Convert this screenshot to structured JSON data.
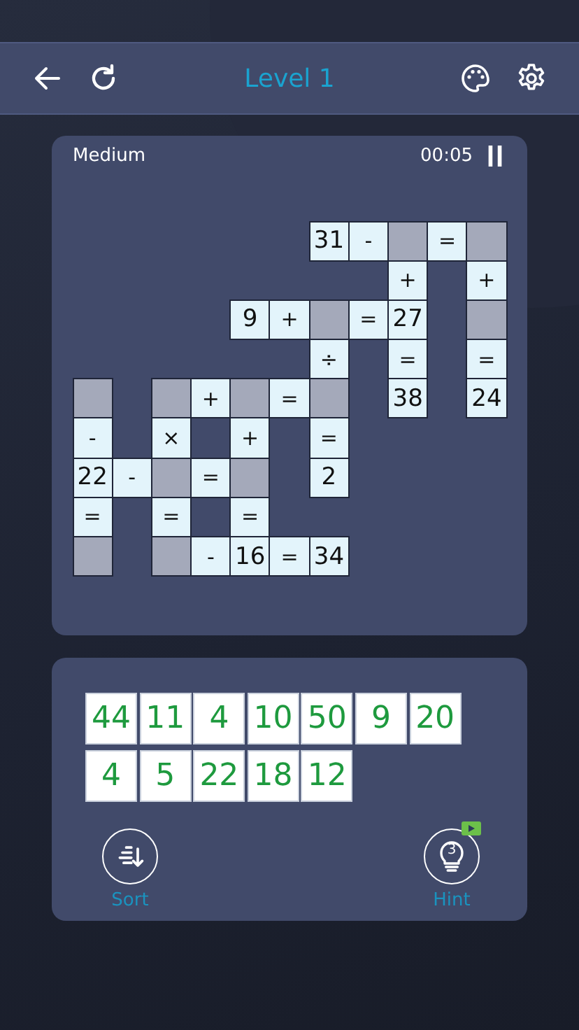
{
  "header": {
    "title": "Level 1"
  },
  "board": {
    "difficulty": "Medium",
    "timer": "00:05",
    "rows": [
      [
        {
          "kind": "gap"
        },
        {
          "kind": "gap"
        },
        {
          "kind": "gap"
        },
        {
          "kind": "gap"
        },
        {
          "kind": "gap"
        },
        {
          "kind": "gap"
        },
        {
          "kind": "number",
          "text": "31"
        },
        {
          "kind": "operator",
          "text": "-"
        },
        {
          "kind": "blank"
        },
        {
          "kind": "operator",
          "text": "="
        },
        {
          "kind": "blank"
        }
      ],
      [
        {
          "kind": "gap"
        },
        {
          "kind": "gap"
        },
        {
          "kind": "gap"
        },
        {
          "kind": "gap"
        },
        {
          "kind": "gap"
        },
        {
          "kind": "gap"
        },
        {
          "kind": "gap"
        },
        {
          "kind": "gap"
        },
        {
          "kind": "operator",
          "text": "+"
        },
        {
          "kind": "gap"
        },
        {
          "kind": "operator",
          "text": "+"
        }
      ],
      [
        {
          "kind": "gap"
        },
        {
          "kind": "gap"
        },
        {
          "kind": "gap"
        },
        {
          "kind": "gap"
        },
        {
          "kind": "number",
          "text": "9"
        },
        {
          "kind": "operator",
          "text": "+"
        },
        {
          "kind": "blank"
        },
        {
          "kind": "operator",
          "text": "="
        },
        {
          "kind": "number",
          "text": "27"
        },
        {
          "kind": "gap"
        },
        {
          "kind": "blank"
        }
      ],
      [
        {
          "kind": "gap"
        },
        {
          "kind": "gap"
        },
        {
          "kind": "gap"
        },
        {
          "kind": "gap"
        },
        {
          "kind": "gap"
        },
        {
          "kind": "gap"
        },
        {
          "kind": "operator",
          "text": "÷"
        },
        {
          "kind": "gap"
        },
        {
          "kind": "operator",
          "text": "="
        },
        {
          "kind": "gap"
        },
        {
          "kind": "operator",
          "text": "="
        }
      ],
      [
        {
          "kind": "blank"
        },
        {
          "kind": "gap"
        },
        {
          "kind": "blank"
        },
        {
          "kind": "operator",
          "text": "+"
        },
        {
          "kind": "blank"
        },
        {
          "kind": "operator",
          "text": "="
        },
        {
          "kind": "blank"
        },
        {
          "kind": "gap"
        },
        {
          "kind": "number",
          "text": "38"
        },
        {
          "kind": "gap"
        },
        {
          "kind": "number",
          "text": "24"
        }
      ],
      [
        {
          "kind": "operator",
          "text": "-"
        },
        {
          "kind": "gap"
        },
        {
          "kind": "operator",
          "text": "×"
        },
        {
          "kind": "gap"
        },
        {
          "kind": "operator",
          "text": "+"
        },
        {
          "kind": "gap"
        },
        {
          "kind": "operator",
          "text": "="
        }
      ],
      [
        {
          "kind": "number",
          "text": "22"
        },
        {
          "kind": "operator",
          "text": "-"
        },
        {
          "kind": "blank"
        },
        {
          "kind": "operator",
          "text": "="
        },
        {
          "kind": "blank"
        },
        {
          "kind": "gap"
        },
        {
          "kind": "number",
          "text": "2"
        }
      ],
      [
        {
          "kind": "operator",
          "text": "="
        },
        {
          "kind": "gap"
        },
        {
          "kind": "operator",
          "text": "="
        },
        {
          "kind": "gap"
        },
        {
          "kind": "operator",
          "text": "="
        }
      ],
      [
        {
          "kind": "blank"
        },
        {
          "kind": "gap"
        },
        {
          "kind": "blank"
        },
        {
          "kind": "operator",
          "text": "-"
        },
        {
          "kind": "number",
          "text": "16"
        },
        {
          "kind": "operator",
          "text": "="
        },
        {
          "kind": "number",
          "text": "34"
        }
      ]
    ]
  },
  "tray": {
    "tiles": [
      "44",
      "11",
      "4",
      "10",
      "50",
      "9",
      "20",
      "4",
      "5",
      "22",
      "18",
      "12"
    ],
    "actions": [
      {
        "kind": "sort",
        "label": "Sort"
      },
      {
        "kind": "hint",
        "label": "Hint",
        "count": "3"
      }
    ]
  }
}
